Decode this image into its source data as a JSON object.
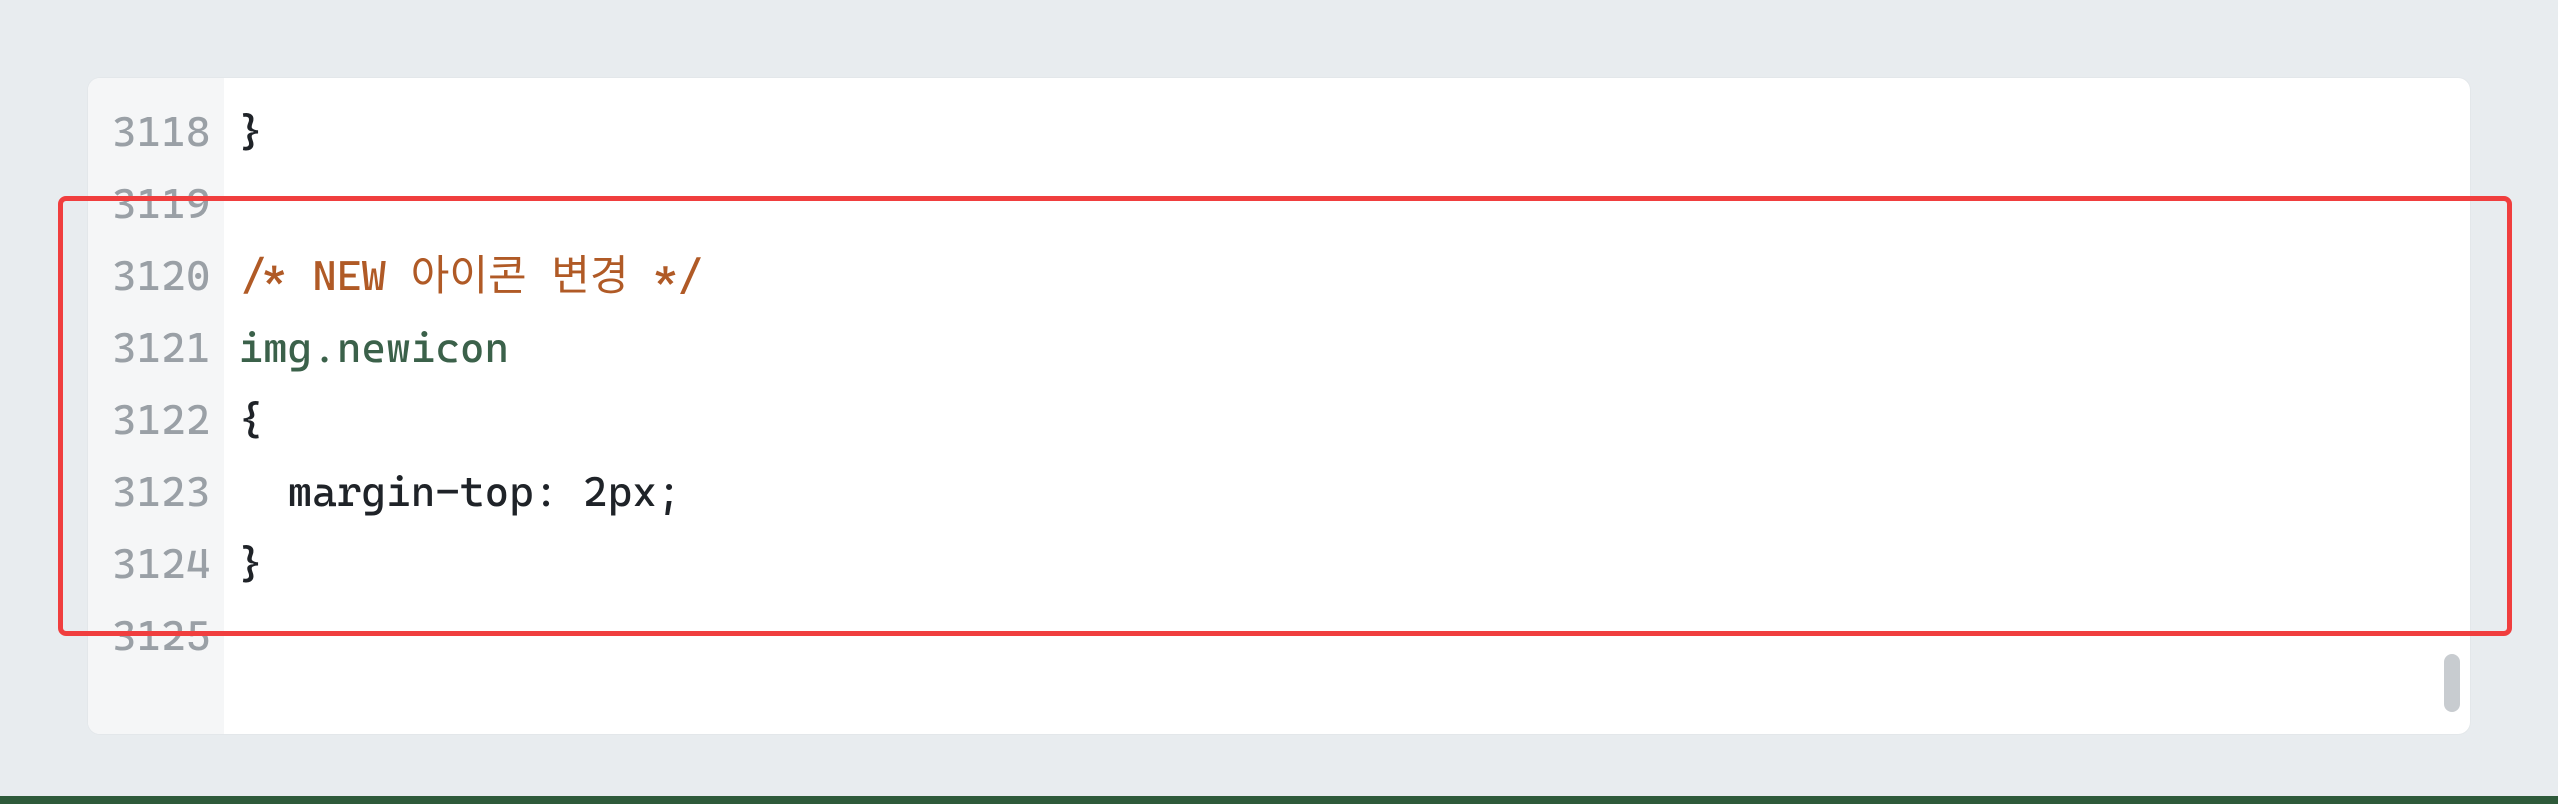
{
  "lines": [
    {
      "num": "3118",
      "tokens": [
        {
          "cls": "tok-brace",
          "text": "}"
        }
      ]
    },
    {
      "num": "3119",
      "tokens": []
    },
    {
      "num": "3120",
      "tokens": [
        {
          "cls": "tok-comment",
          "text": "/* NEW 아이콘 변경 */"
        }
      ]
    },
    {
      "num": "3121",
      "tokens": [
        {
          "cls": "tok-selector",
          "text": "img.newicon"
        }
      ]
    },
    {
      "num": "3122",
      "tokens": [
        {
          "cls": "tok-brace",
          "text": "{"
        }
      ]
    },
    {
      "num": "3123",
      "tokens": [
        {
          "cls": "tok-indent",
          "text": "  "
        },
        {
          "cls": "tok-prop",
          "text": "margin-top"
        },
        {
          "cls": "tok-colon",
          "text": ": "
        },
        {
          "cls": "tok-value",
          "text": "2px"
        },
        {
          "cls": "tok-semi",
          "text": ";"
        }
      ]
    },
    {
      "num": "3124",
      "tokens": [
        {
          "cls": "tok-brace",
          "text": "}"
        }
      ]
    },
    {
      "num": "3125",
      "tokens": []
    }
  ]
}
